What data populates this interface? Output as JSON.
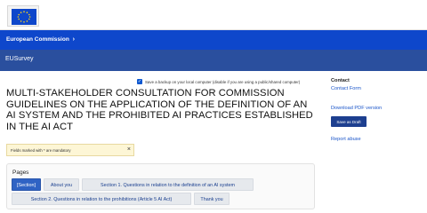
{
  "header": {
    "ec_label": "European Commission",
    "ec_chevron": "›",
    "app_name": "EUSurvey",
    "logo_icon": "eu-flag-icon"
  },
  "colors": {
    "primary_blue": "#0e47cb",
    "app_bar": "#2a4f9e",
    "active_tab": "#2f63c4",
    "link": "#1a55c9",
    "notice_bg": "#fdf6d6"
  },
  "backup": {
    "checked": true,
    "label": "Save a backup on your local computer (disable if you are using a public/shared computer)"
  },
  "survey": {
    "title": "MULTI-STAKEHOLDER CONSULTATION FOR COMMISSION GUIDELINES ON THE APPLICATION OF THE DEFINITION OF AN AI SYSTEM AND THE PROHIBITED AI PRACTICES ESTABLISHED IN THE AI ACT"
  },
  "notice": {
    "text": "Fields marked with * are mandatory",
    "close_glyph": "×"
  },
  "pages": {
    "title": "Pages",
    "tabs": [
      {
        "label": "[Section]",
        "active": true
      },
      {
        "label": "About you",
        "active": false
      },
      {
        "label": "Section 1. Questions in relation to the definition of an AI system",
        "active": false
      },
      {
        "label": "Section 2. Questions in relation to the prohibitions (Article 5 AI Act)",
        "active": false
      },
      {
        "label": "Thank you",
        "active": false
      }
    ]
  },
  "sidebar": {
    "contact_heading": "Contact",
    "contact_form": "Contact Form",
    "download_pdf": "Download PDF version",
    "save_draft": "Save as Draft",
    "report_abuse": "Report abuse"
  }
}
